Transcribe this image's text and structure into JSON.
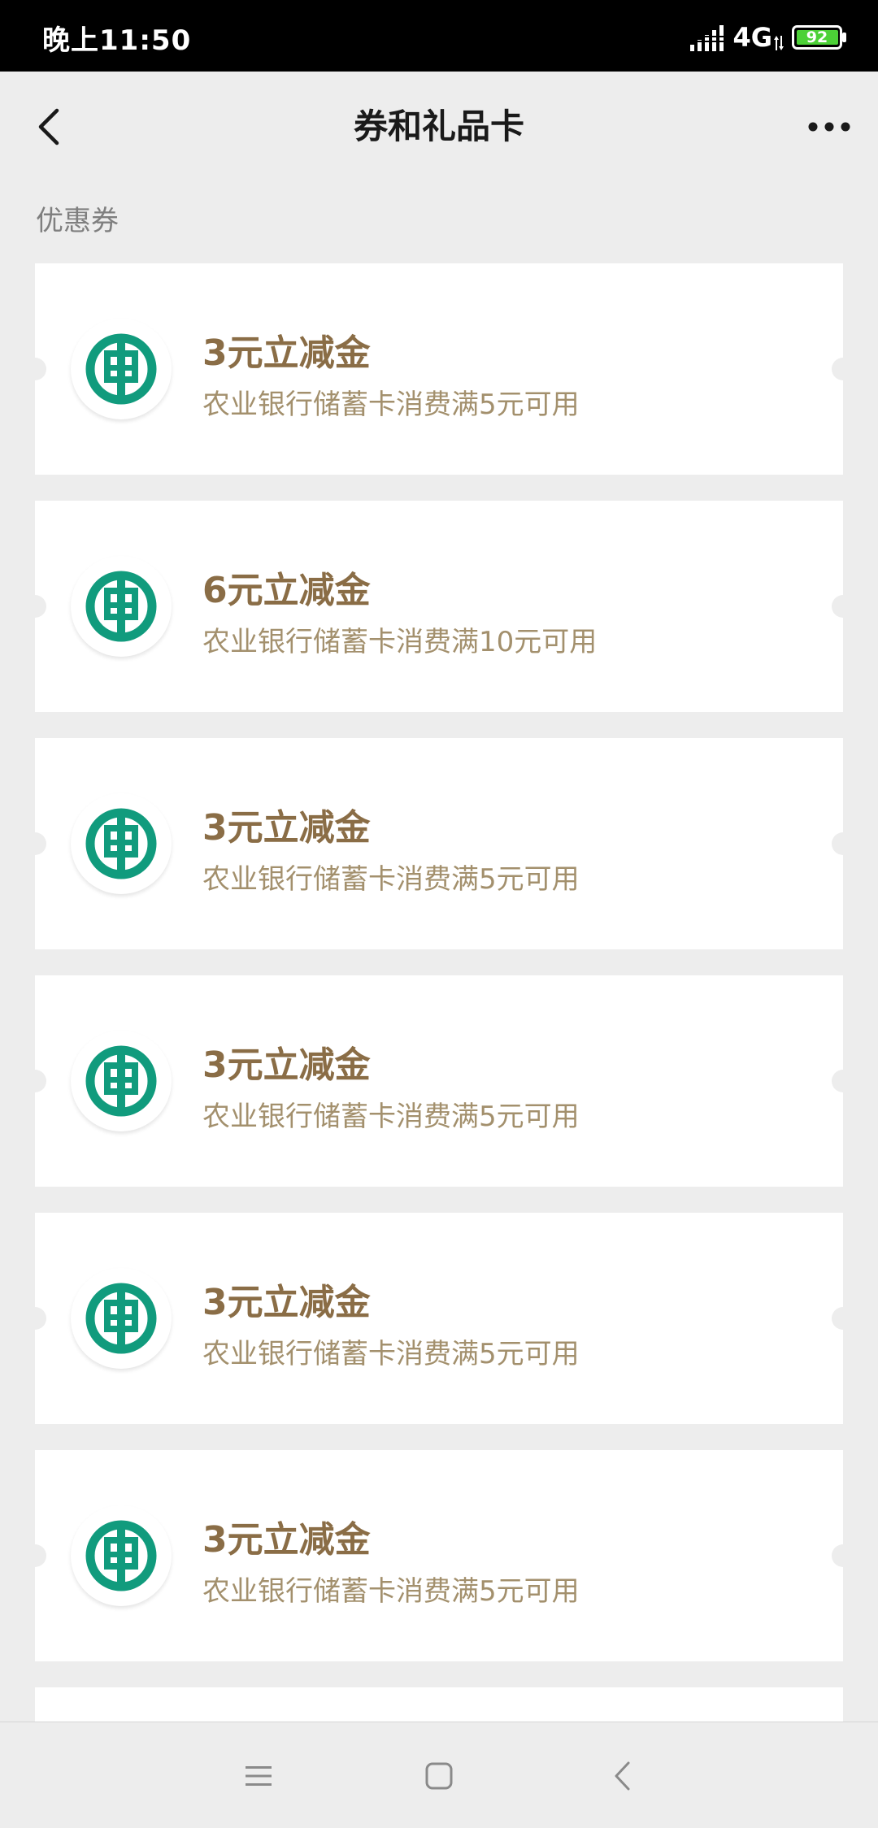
{
  "status_bar": {
    "time": "晚上11:50",
    "network": "4G",
    "battery": "92"
  },
  "nav": {
    "title": "券和礼品卡"
  },
  "section": {
    "label": "优惠券"
  },
  "coupons": [
    {
      "title": "3元立减金",
      "desc": "农业银行储蓄卡消费满5元可用"
    },
    {
      "title": "6元立减金",
      "desc": "农业银行储蓄卡消费满10元可用"
    },
    {
      "title": "3元立减金",
      "desc": "农业银行储蓄卡消费满5元可用"
    },
    {
      "title": "3元立减金",
      "desc": "农业银行储蓄卡消费满5元可用"
    },
    {
      "title": "3元立减金",
      "desc": "农业银行储蓄卡消费满5元可用"
    },
    {
      "title": "3元立减金",
      "desc": "农业银行储蓄卡消费满5元可用"
    }
  ],
  "colors": {
    "title_text": "#1a1a1a",
    "coupon_title": "#8a6d46",
    "coupon_desc": "#a3906d",
    "abc_green": "#119b7d",
    "battery_green": "#4cd137",
    "background": "#ededed"
  },
  "icons": {
    "back": "chevron-left-icon",
    "more": "more-dots-icon",
    "logo": "abc-bank-logo-icon",
    "sys_menu": "menu-lines-icon",
    "sys_home": "home-square-icon",
    "sys_back": "chevron-left-icon"
  }
}
